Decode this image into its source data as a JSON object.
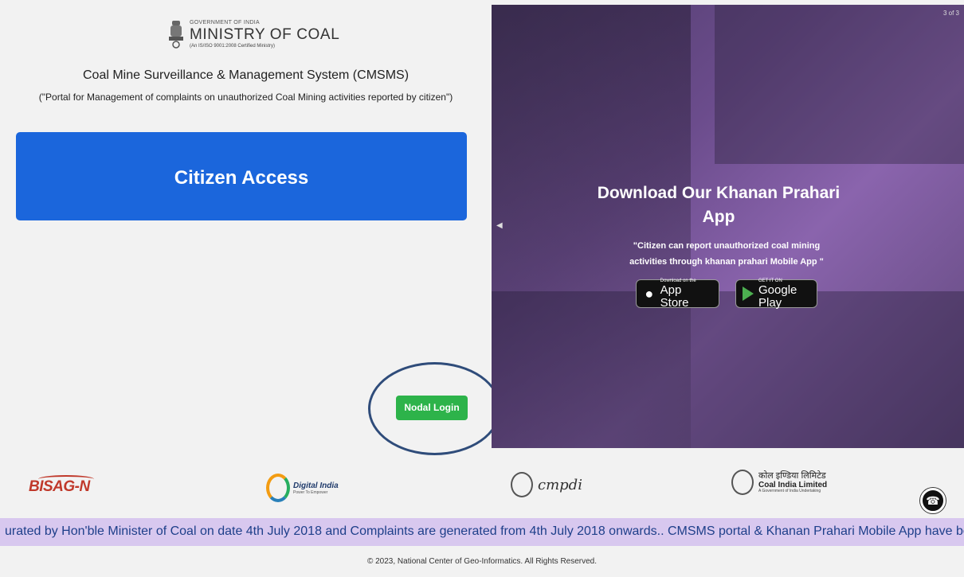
{
  "header": {
    "gov_label": "GOVERNMENT OF INDIA",
    "ministry": "MINISTRY OF COAL",
    "certification": "(An IS/ISO 9001:2008 Certified Ministry)",
    "system_title": "Coal Mine Surveillance & Management System (CMSMS)",
    "system_subtitle": "(\"Portal for Management of complaints on unauthorized Coal Mining activities reported by citizen\")"
  },
  "actions": {
    "citizen_access": "Citizen Access",
    "nodal_login": "Nodal Login"
  },
  "slider": {
    "counter": "3 of 3",
    "title_line1": "Download Our Khanan Prahari",
    "title_line2": "App",
    "description_line1": "\"Citizen can report unauthorized coal mining",
    "description_line2": "activities through khanan prahari Mobile App \"",
    "appstore_small": "Download on the",
    "appstore_big": "App Store",
    "googleplay_small": "GET IT ON",
    "googleplay_big": "Google Play"
  },
  "partners": {
    "bisag": "BISAG-N",
    "digital_india": "Digital India",
    "digital_india_tag": "Power To Empower",
    "cmpdi": "cmpdi",
    "coal_india_hindi": "कोल इण्डिया लिमिटेड",
    "coal_india": "Coal India Limited",
    "coal_india_tag": "A Government of India Undertaking"
  },
  "marquee": {
    "text": "urated by Hon'ble Minister of Coal on date 4th July 2018 and Complaints are generated from 4th July 2018 onwards..   CMSMS portal & Khanan Prahari Mobile App have been inaug"
  },
  "footer": {
    "copyright": "© 2023, National Center of Geo-Informatics. All Rights Reserved."
  },
  "colors": {
    "citizen_button": "#1b66dc",
    "nodal_button": "#2db34a",
    "highlight_circle": "#2f4c7a",
    "marquee_bg": "#d8c8ef"
  }
}
